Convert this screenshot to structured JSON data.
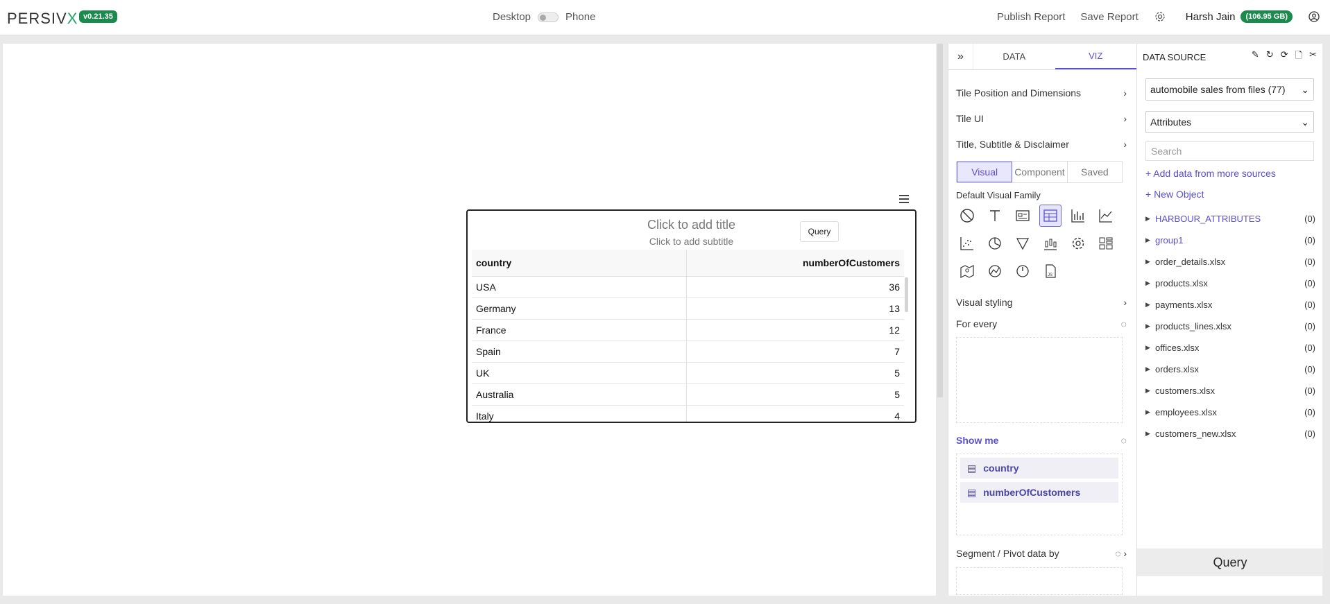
{
  "header": {
    "logo_main": "PERSIV",
    "logo_x": "X",
    "version": "v0.21.35",
    "device_desktop": "Desktop",
    "device_phone": "Phone",
    "publish": "Publish Report",
    "save": "Save Report",
    "user": "Harsh Jain",
    "storage": "(106.95 GB)"
  },
  "tile": {
    "title_placeholder": "Click to add title",
    "subtitle_placeholder": "Click to add subtitle",
    "query_label": "Query",
    "columns": [
      "country",
      "numberOfCustomers"
    ],
    "rows": [
      [
        "USA",
        "36"
      ],
      [
        "Germany",
        "13"
      ],
      [
        "France",
        "12"
      ],
      [
        "Spain",
        "7"
      ],
      [
        "UK",
        "5"
      ],
      [
        "Australia",
        "5"
      ],
      [
        "Italy",
        "4"
      ]
    ]
  },
  "viz": {
    "tabs": [
      "DATA",
      "VIZ"
    ],
    "sections": [
      "Tile Position and Dimensions",
      "Tile UI",
      "Title, Subtitle & Disclaimer"
    ],
    "visual_tabs": [
      "Visual",
      "Component",
      "Saved"
    ],
    "family_label": "Default Visual Family",
    "icons": [
      "none-icon",
      "text-icon",
      "card-icon",
      "table-icon",
      "bar-chart-icon",
      "line-chart-icon",
      "scatter-icon",
      "pie-icon",
      "funnel-icon",
      "candlestick-icon",
      "gear-icon",
      "layout-icon",
      "map-icon",
      "network-icon",
      "gauge-icon",
      "js-file-icon"
    ],
    "visual_styling": "Visual styling",
    "for_every": "For every",
    "show_me": "Show me",
    "fields": [
      "country",
      "numberOfCustomers"
    ],
    "segment": "Segment / Pivot data by"
  },
  "datasource": {
    "title": "DATA SOURCE",
    "source": "automobile sales from files (77)",
    "attributes": "Attributes",
    "search_placeholder": "Search",
    "add_more": "+ Add data from more sources",
    "new_object": "+ New Object",
    "items": [
      {
        "name": "HARBOUR_ATTRIBUTES",
        "count": "(0)"
      },
      {
        "name": "group1",
        "count": "(0)"
      },
      {
        "name": "order_details.xlsx",
        "count": "(0)"
      },
      {
        "name": "products.xlsx",
        "count": "(0)"
      },
      {
        "name": "payments.xlsx",
        "count": "(0)"
      },
      {
        "name": "products_lines.xlsx",
        "count": "(0)"
      },
      {
        "name": "offices.xlsx",
        "count": "(0)"
      },
      {
        "name": "orders.xlsx",
        "count": "(0)"
      },
      {
        "name": "customers.xlsx",
        "count": "(0)"
      },
      {
        "name": "employees.xlsx",
        "count": "(0)"
      },
      {
        "name": "customers_new.xlsx",
        "count": "(0)"
      }
    ],
    "query_button": "Query"
  },
  "colors": {
    "accent": "#5a4fcf",
    "brand_green": "#1b8a4c"
  }
}
